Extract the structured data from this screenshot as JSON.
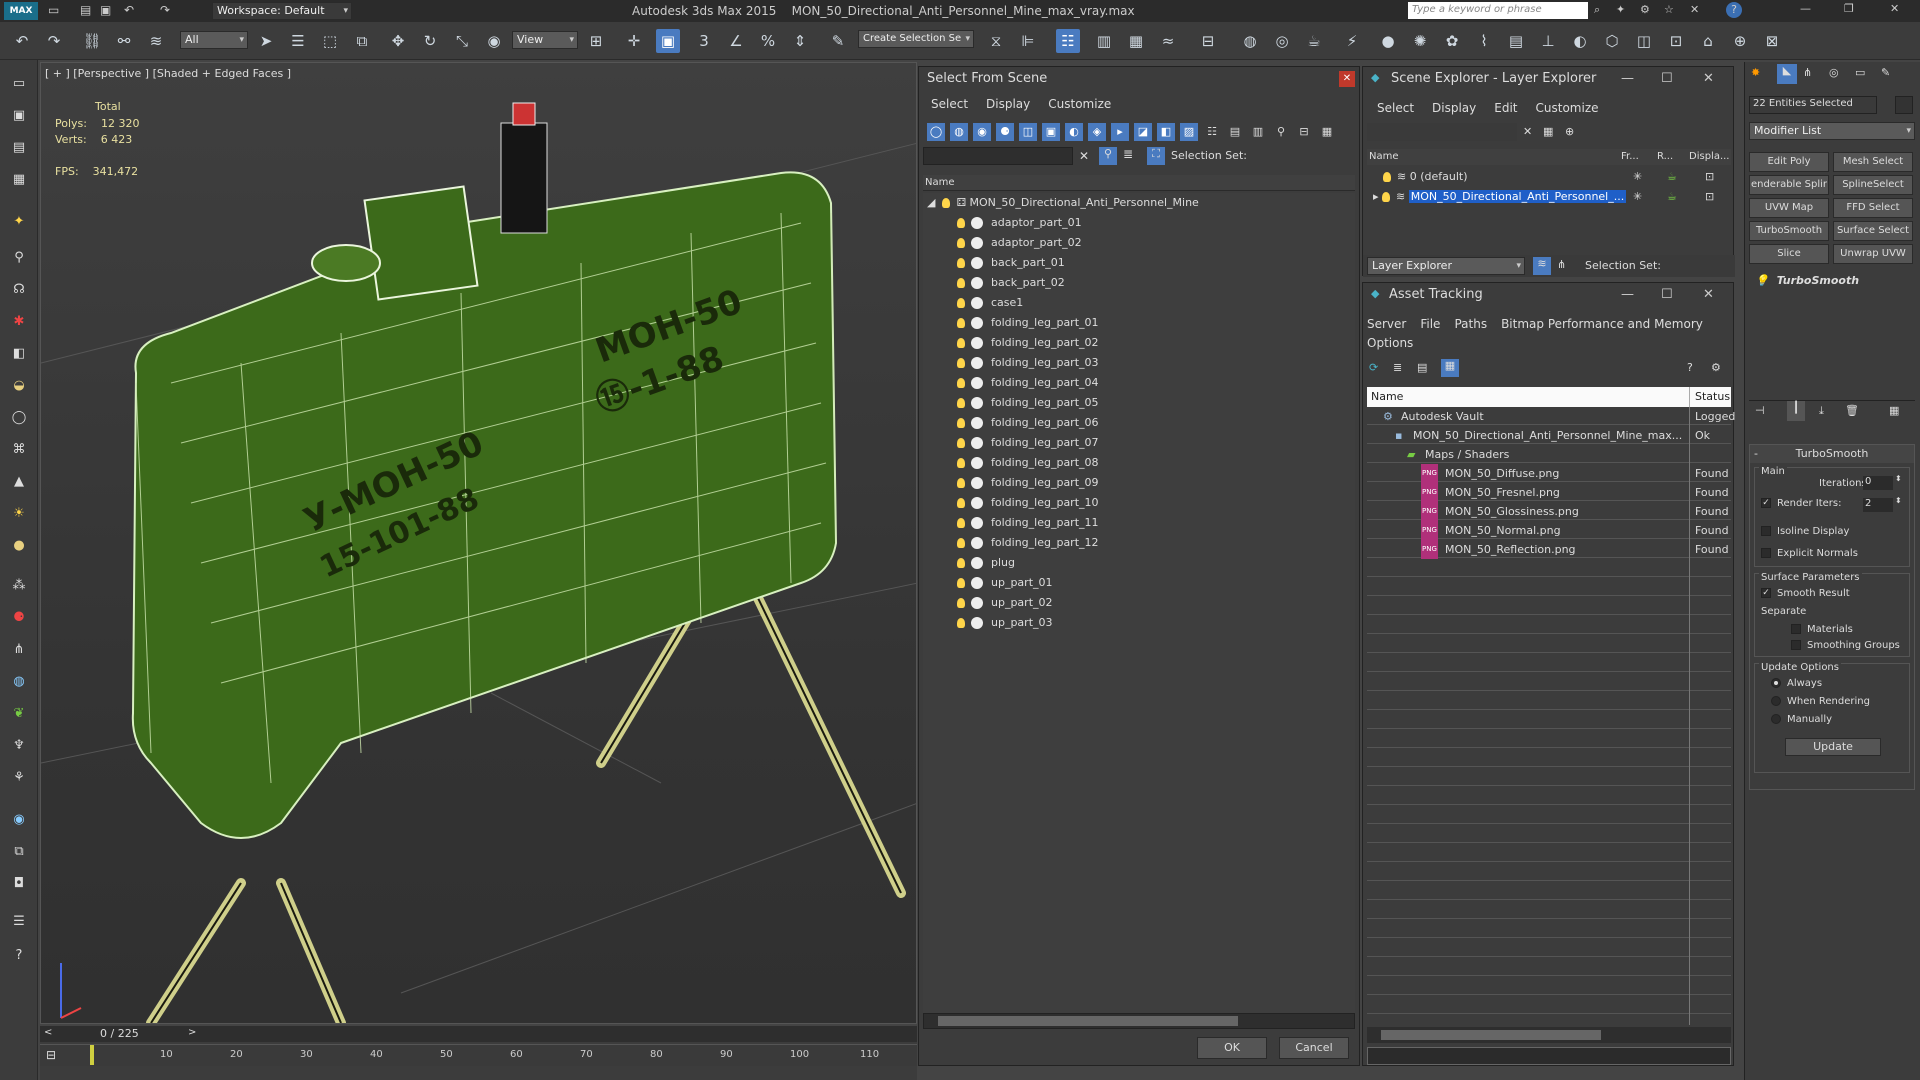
{
  "titlebar": {
    "app": "Autodesk 3ds Max  2015",
    "file": "MON_50_Directional_Anti_Personnel_Mine_max_vray.max",
    "workspace": "Workspace: Default",
    "search_placeholder": "Type a keyword or phrase"
  },
  "toolbar": {
    "selection_filter": "All",
    "ref_coord": "View",
    "selection_set": "Create Selection Se"
  },
  "viewport": {
    "label": "[ + ] [Perspective ] [Shaded + Edged Faces ]",
    "stats_header": "Total",
    "polys_label": "Polys:",
    "polys_value": "12 320",
    "verts_label": "Verts:",
    "verts_value": "6 423",
    "fps_label": "FPS:",
    "fps_value": "341,472",
    "stencil_top": "МОН-50",
    "stencil_top2": "⑮-1-88",
    "stencil_left": "У-МОН-50",
    "stencil_left2": "15-101-88"
  },
  "timeline": {
    "frame": "0 / 225",
    "ticks": [
      "10",
      "20",
      "30",
      "40",
      "50",
      "60",
      "70",
      "80",
      "90",
      "100",
      "110"
    ]
  },
  "select_from_scene": {
    "title": "Select From Scene",
    "menu": [
      "Select",
      "Display",
      "Customize"
    ],
    "selection_set_label": "Selection Set:",
    "column": "Name",
    "root": "MON_50_Directional_Anti_Personnel_Mine",
    "items": [
      "adaptor_part_01",
      "adaptor_part_02",
      "back_part_01",
      "back_part_02",
      "case1",
      "folding_leg_part_01",
      "folding_leg_part_02",
      "folding_leg_part_03",
      "folding_leg_part_04",
      "folding_leg_part_05",
      "folding_leg_part_06",
      "folding_leg_part_07",
      "folding_leg_part_08",
      "folding_leg_part_09",
      "folding_leg_part_10",
      "folding_leg_part_11",
      "folding_leg_part_12",
      "plug",
      "up_part_01",
      "up_part_02",
      "up_part_03"
    ],
    "ok": "OK",
    "cancel": "Cancel"
  },
  "scene_explorer": {
    "title": "Scene Explorer - Layer Explorer",
    "menu": [
      "Select",
      "Display",
      "Edit",
      "Customize"
    ],
    "columns": [
      "Name",
      "Fr...",
      "R...",
      "Displa..."
    ],
    "layers": [
      "0 (default)",
      "MON_50_Directional_Anti_Personnel_..."
    ],
    "footer_dropdown": "Layer Explorer",
    "selection_set_label": "Selection Set:"
  },
  "asset_tracking": {
    "title": "Asset Tracking",
    "menu": [
      "Server",
      "File",
      "Paths",
      "Bitmap Performance and Memory",
      "Options"
    ],
    "columns": [
      "Name",
      "Status"
    ],
    "rows": [
      {
        "name": "Autodesk Vault",
        "status": "Logged",
        "indent": 1
      },
      {
        "name": "MON_50_Directional_Anti_Personnel_Mine_max...",
        "status": "Ok",
        "indent": 2
      },
      {
        "name": "Maps / Shaders",
        "status": "",
        "indent": 3
      },
      {
        "name": "MON_50_Diffuse.png",
        "status": "Found",
        "indent": 4
      },
      {
        "name": "MON_50_Fresnel.png",
        "status": "Found",
        "indent": 4
      },
      {
        "name": "MON_50_Glossiness.png",
        "status": "Found",
        "indent": 4
      },
      {
        "name": "MON_50_Normal.png",
        "status": "Found",
        "indent": 4
      },
      {
        "name": "MON_50_Reflection.png",
        "status": "Found",
        "indent": 4
      }
    ]
  },
  "command_panel": {
    "selection": "22 Entities Selected",
    "modifier_list": "Modifier List",
    "buttons": [
      "Edit Poly",
      "Mesh Select",
      "enderable Splir",
      "SplineSelect",
      "UVW Map",
      "FFD Select",
      "TurboSmooth",
      "Surface Select",
      "Slice",
      "Unwrap UVW"
    ],
    "stack_item": "TurboSmooth",
    "rollout_title": "TurboSmooth",
    "main_label": "Main",
    "iterations_label": "Iterations:",
    "iterations_value": "0",
    "render_iters_label": "Render Iters:",
    "render_iters_value": "2",
    "isoline": "Isoline Display",
    "explicit": "Explicit Normals",
    "surface_params": "Surface Parameters",
    "smooth_result": "Smooth Result",
    "separate": "Separate",
    "materials": "Materials",
    "smoothing_groups": "Smoothing Groups",
    "update_options": "Update Options",
    "always": "Always",
    "when_rendering": "When Rendering",
    "manually": "Manually",
    "update_btn": "Update"
  },
  "colors": {
    "accent": "#4a7bc0",
    "mine_green": "#3c6a1a",
    "selection_blue": "#1f5fc8"
  }
}
